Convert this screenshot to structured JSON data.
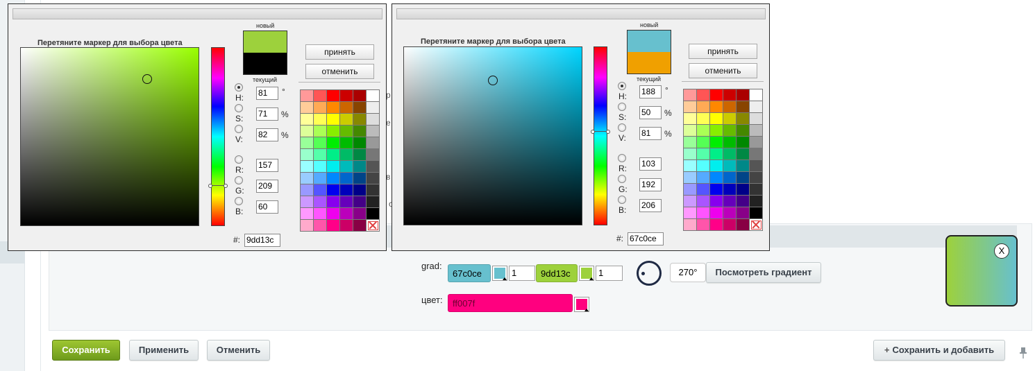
{
  "background": {
    "edge_letters": [
      "р",
      "е",
      "в",
      "с"
    ]
  },
  "gradient_form": {
    "grad_label": "grad:",
    "color_label": "цвет:",
    "stop1": {
      "hex": "67c0ce",
      "color": "#67c0ce",
      "position": "1"
    },
    "stop2": {
      "hex": "9dd13c",
      "color": "#9dd13c",
      "position": "1"
    },
    "angle": "270°",
    "view_gradient_label": "Посмотреть градиент",
    "color_value": "ff007f",
    "color_fill": "#ff007f",
    "preview_close": "X"
  },
  "footer": {
    "save_label": "Сохранить",
    "apply_label": "Применить",
    "cancel_label": "Отменить",
    "save_add_label": "Сохранить и добавить"
  },
  "pickers": [
    {
      "hint": "Перетяните маркер для выбора цвета",
      "hue_color": "#99ff00",
      "new_label": "новый",
      "current_label": "текущий",
      "new_color": "#9dd13c",
      "current_color": "#000000",
      "H": "81",
      "S": "71",
      "V": "82",
      "R": "157",
      "G": "209",
      "B": "60",
      "hex": "9dd13c",
      "hue_level": 0.775,
      "sv_saturation": 0.71,
      "sv_value": 0.82,
      "accept_label": "принять",
      "cancel_label": "отменить",
      "labels": {
        "h": "H:",
        "s": "S:",
        "v": "V:",
        "r": "R:",
        "g": "G:",
        "b": "B:",
        "hash": "#:",
        "deg": "°",
        "pct": "%"
      }
    },
    {
      "hint": "Перетяните маркер для выбора цвета",
      "hue_color": "#00d5ff",
      "new_label": "новый",
      "current_label": "текущий",
      "new_color": "#67c0ce",
      "current_color": "#f0a000",
      "H": "188",
      "S": "50",
      "V": "81",
      "R": "103",
      "G": "192",
      "B": "206",
      "hex": "67c0ce",
      "hue_level": 0.475,
      "sv_saturation": 0.5,
      "sv_value": 0.81,
      "accept_label": "принять",
      "cancel_label": "отменить",
      "labels": {
        "h": "H:",
        "s": "S:",
        "v": "V:",
        "r": "R:",
        "g": "G:",
        "b": "B:",
        "hash": "#:",
        "deg": "°",
        "pct": "%"
      }
    }
  ],
  "palette_colors": [
    "#ff9999",
    "#ff5555",
    "#ff0000",
    "#cc0000",
    "#aa0000",
    "#ffffff",
    "#ffcc99",
    "#ffaa55",
    "#ff8800",
    "#cc6600",
    "#884400",
    "#eeeeee",
    "#ffff99",
    "#ffff55",
    "#ffff00",
    "#cccc00",
    "#888800",
    "#dddddd",
    "#ddff99",
    "#aaff55",
    "#88ee00",
    "#66bb00",
    "#448800",
    "#bbbbbb",
    "#99ff99",
    "#55ff55",
    "#00ee00",
    "#00bb00",
    "#008800",
    "#999999",
    "#99ffcc",
    "#55ffaa",
    "#00ee88",
    "#00bb66",
    "#008844",
    "#777777",
    "#99ffff",
    "#55ffff",
    "#00eeee",
    "#00bbbb",
    "#008888",
    "#555555",
    "#99ccff",
    "#55aaff",
    "#0088ff",
    "#0066cc",
    "#004488",
    "#444444",
    "#9999ff",
    "#5555ff",
    "#0000ee",
    "#0000bb",
    "#000088",
    "#333333",
    "#cc99ff",
    "#aa55ff",
    "#8800ee",
    "#6600bb",
    "#440088",
    "#222222",
    "#ff99ff",
    "#ff55ff",
    "#ee00ee",
    "#bb00bb",
    "#880088",
    "#000000",
    "#ffaacc",
    "#ff55aa",
    "#ff0088",
    "#cc0066",
    "#880044",
    "none"
  ]
}
